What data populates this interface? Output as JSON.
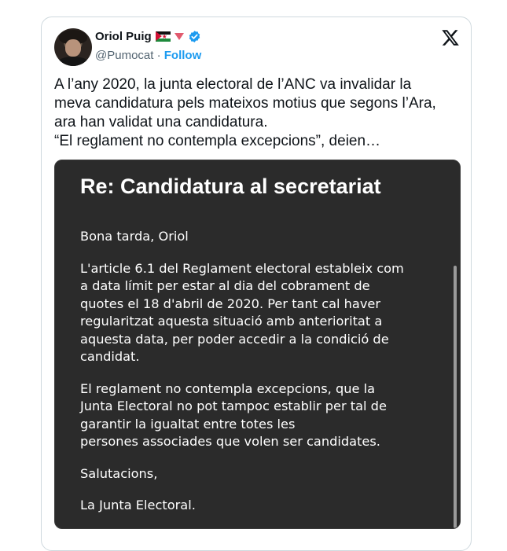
{
  "author": {
    "name": "Oriol Puig",
    "handle": "@Pumocat",
    "separator": "·",
    "follow_label": "Follow"
  },
  "icons": {
    "flag": "sahrawi-flag-icon",
    "triangle": "red-triangle-down-icon",
    "verified": "verified-badge-icon",
    "logo": "x-logo-icon"
  },
  "colors": {
    "follow": "#1d9bf0",
    "verified": "#1d9bf0",
    "media_bg": "#2b2b2b"
  },
  "tweet": {
    "lines": [
      "A l’any 2020, la junta electoral de l’ANC va invalidar la",
      "meva candidatura pels mateixos motius que segons l’Ara,",
      "ara han validat una candidatura.",
      "“El reglament no contempla excepcions”, deien…"
    ]
  },
  "email": {
    "title": "Re: Candidatura al secretariat",
    "greeting": "Bona tarda, Oriol",
    "paragraph1": [
      "L'article 6.1 del Reglament electoral estableix com",
      "a data límit per estar al dia del cobrament de",
      "quotes el 18 d'abril de 2020. Per tant cal haver",
      "regularitzat aquesta situació amb anterioritat a",
      "aquesta data, per poder accedir a la condició de",
      "candidat."
    ],
    "paragraph2": [
      "El reglament no contempla excepcions, que la",
      "Junta Electoral no pot tampoc establir per tal de",
      "garantir la igualtat entre totes les",
      "persones associades que volen ser candidates."
    ],
    "closing": "Salutacions,",
    "signature": "La Junta Electoral."
  }
}
